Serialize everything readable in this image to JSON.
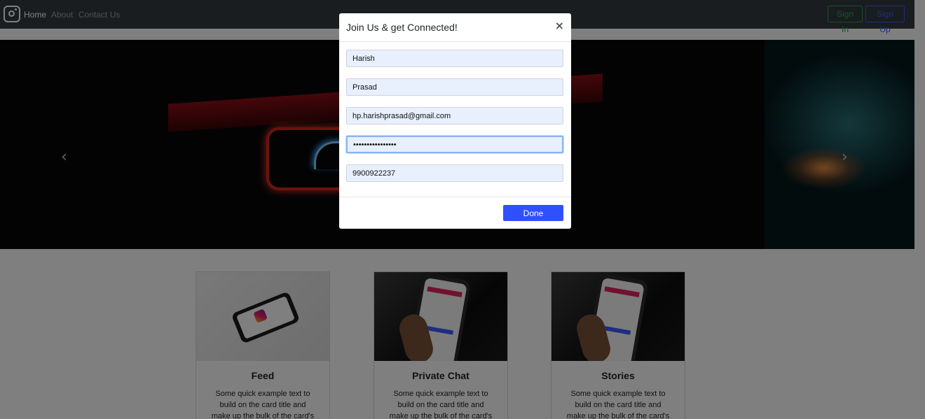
{
  "navbar": {
    "links": [
      "Home",
      "About",
      "Contact Us"
    ],
    "signin_label": "Sign In",
    "signup_label": "Sign Up",
    "brand_icon": "instagram-icon"
  },
  "carousel": {
    "prev_icon": "chevron-left-icon",
    "next_icon": "chevron-right-icon",
    "prev_glyph": "‹",
    "next_glyph": "›"
  },
  "cards": [
    {
      "title": "Feed",
      "text": "Some quick example text to build on the card title and make up the bulk of the card's"
    },
    {
      "title": "Private Chat",
      "text": "Some quick example text to build on the card title and make up the bulk of the card's"
    },
    {
      "title": "Stories",
      "text": "Some quick example text to build on the card title and make up the bulk of the card's"
    }
  ],
  "modal": {
    "title": "Join Us & get Connected!",
    "close_glyph": "×",
    "fields": {
      "first_name": "Harish",
      "last_name": "Prasad",
      "email": "hp.harishprasad@gmail.com",
      "password": "harishprasad1234",
      "phone": "9900922237"
    },
    "done_label": "Done"
  },
  "colors": {
    "navbar_bg": "#343a40",
    "signin_green": "#28a745",
    "signup_blue": "#3d5afe",
    "done_blue": "#304ffe",
    "autofill_bg": "#e8f0fe"
  }
}
